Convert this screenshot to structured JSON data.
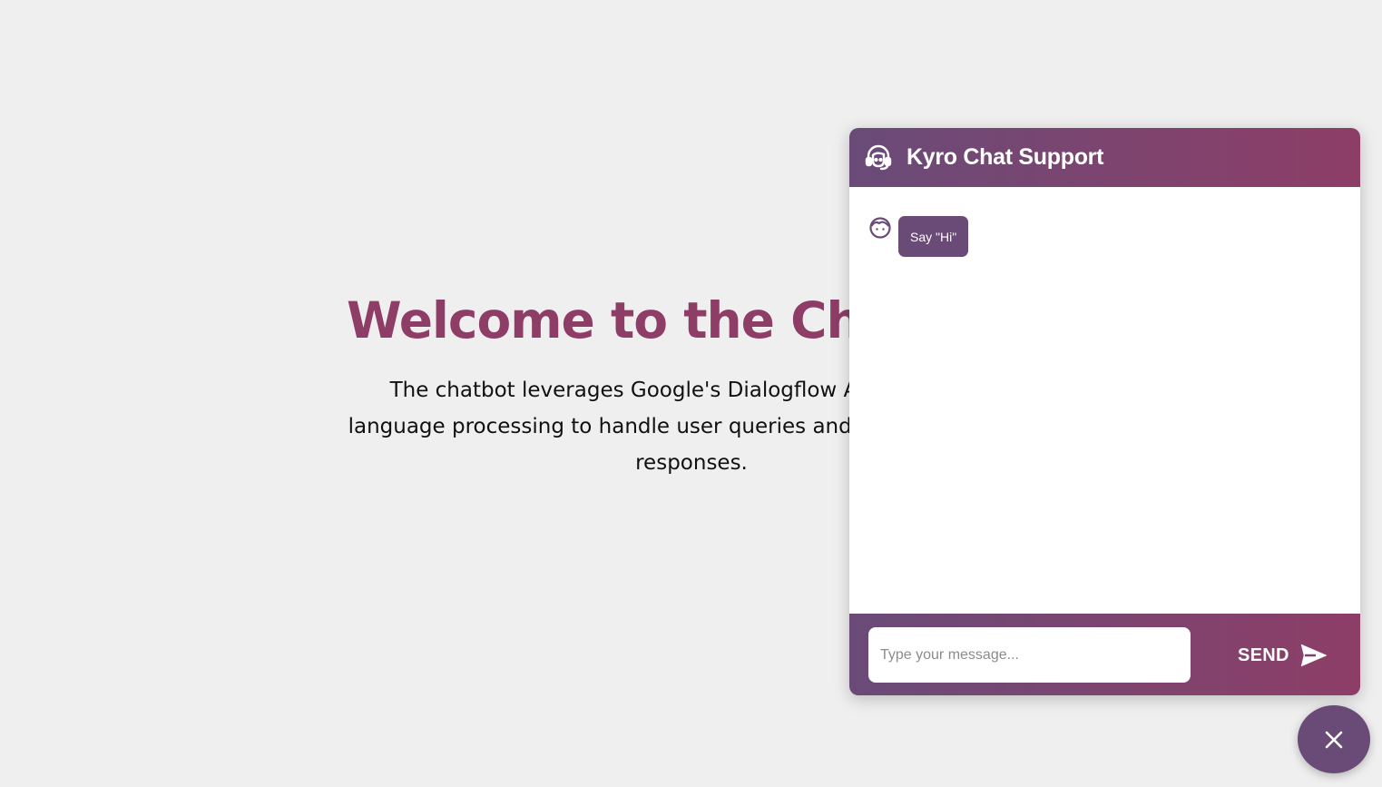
{
  "hero": {
    "title": "Welcome to the Chatbot",
    "description": "The chatbot leverages Google's Dialogflow API for natural language processing to handle user queries and provide accurate responses."
  },
  "chat": {
    "title": "Kyro Chat Support",
    "messages": [
      {
        "sender": "bot",
        "text": "Say \"Hi\""
      }
    ],
    "input_placeholder": "Type your message...",
    "input_value": "",
    "send_label": "SEND"
  },
  "icons": {
    "header": "headset-icon",
    "bot_avatar": "bot-face-icon",
    "send": "send-arrow-icon",
    "close": "close-icon"
  },
  "colors": {
    "background": "#f0efef",
    "title": "#8d3d66",
    "brand_start": "#6a4b78",
    "brand_end": "#8d3e67",
    "bubble": "#6a4b78"
  }
}
